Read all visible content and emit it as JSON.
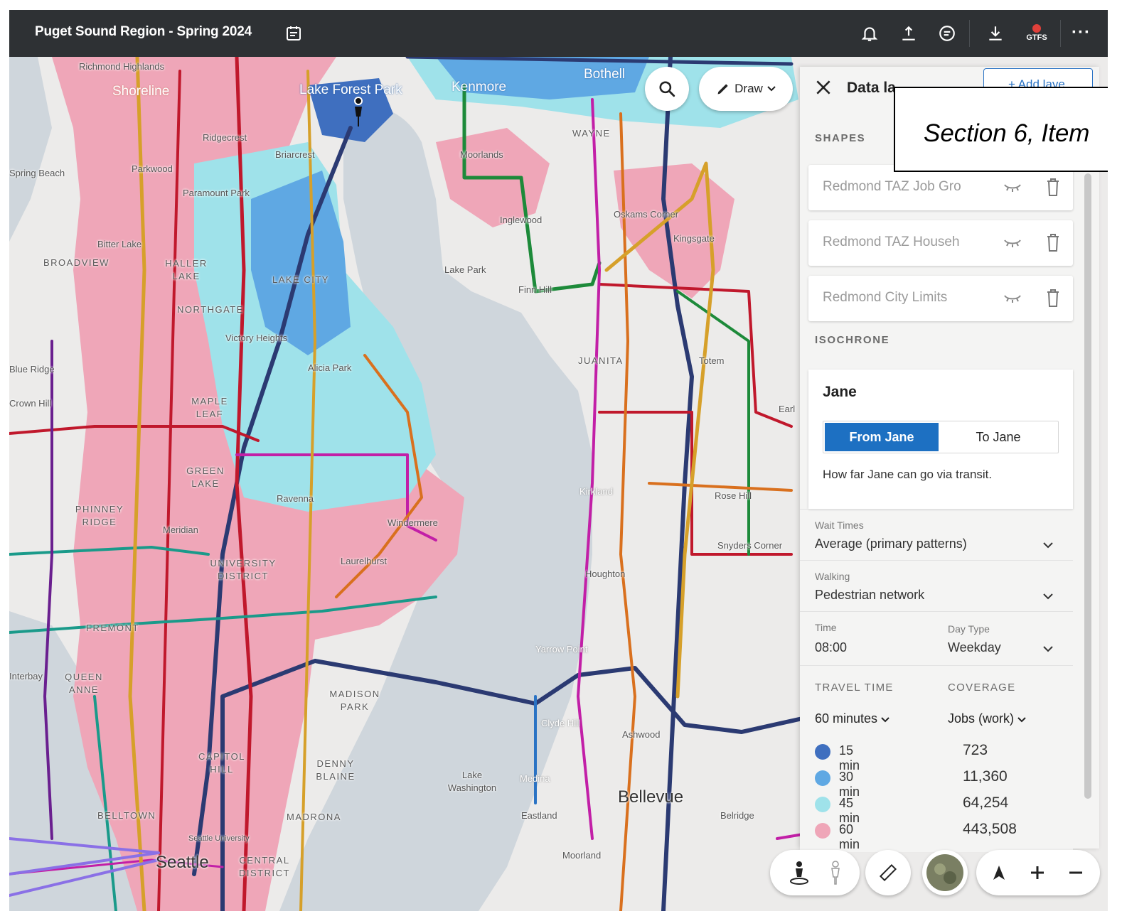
{
  "app": {
    "title": "Puget Sound Region - Spring 2024",
    "gtfs_label": "GTFS"
  },
  "toolbar": {
    "icons": [
      "calendar-icon",
      "bell-icon",
      "share-icon",
      "comment-icon",
      "download-icon",
      "gtfs-icon",
      "more-icon"
    ],
    "more_label": "···"
  },
  "map_controls": {
    "draw_label": "Draw"
  },
  "panel": {
    "title": "Data la",
    "add_layer_label": "+ Add laye",
    "shapes_heading": "SHAPES",
    "shapes": [
      {
        "name": "Redmond TAZ Job Gro"
      },
      {
        "name": "Redmond TAZ Househ"
      },
      {
        "name": "Redmond City Limits"
      }
    ],
    "isochrone_heading": "ISOCHRONE",
    "isochrone": {
      "name": "Jane",
      "from_label": "From Jane",
      "to_label": "To Jane",
      "description": "How far Jane can go via transit.",
      "wait_times_label": "Wait Times",
      "wait_times_value": "Average (primary patterns)",
      "walking_label": "Walking",
      "walking_value": "Pedestrian network",
      "time_label": "Time",
      "time_value": "08:00",
      "day_type_label": "Day Type",
      "day_type_value": "Weekday",
      "travel_time_heading": "TRAVEL TIME",
      "coverage_heading": "COVERAGE",
      "travel_time_value": "60 minutes",
      "coverage_value": "Jobs (work)",
      "legend": [
        {
          "label": "15 min",
          "value": "723",
          "color": "#3f6fbf"
        },
        {
          "label": "30 min",
          "value": "11,360",
          "color": "#5fa8e3"
        },
        {
          "label": "45 min",
          "value": "64,254",
          "color": "#9fe2ea"
        },
        {
          "label": "60 min",
          "value": "443,508",
          "color": "#efa6b8"
        }
      ]
    }
  },
  "callout": {
    "text": "Section 6, Item"
  },
  "map": {
    "labels": [
      "Richmond Highlands",
      "Shoreline",
      "Lake Forest Park",
      "Kenmore",
      "Bothell",
      "Ridgecrest",
      "Briarcrest",
      "Moorlands",
      "WAYNE",
      "Spring Beach",
      "Parkwood",
      "Paramount Park",
      "Inglewood",
      "Oskams Corner",
      "Kingsgate",
      "Bitter Lake",
      "BROADVIEW",
      "HALLER LAKE",
      "LAKE CITY",
      "Lake Park",
      "Finn Hill",
      "NORTHGATE",
      "Victory Heights",
      "Alicia Park",
      "JUANITA",
      "Totem",
      "Blue Ridge",
      "Crown Hill",
      "MAPLE LEAF",
      "Earl",
      "GREEN LAKE",
      "Ravenna",
      "Kirkland",
      "Rose Hill",
      "PHINNEY RIDGE",
      "Meridian",
      "Windermere",
      "Snyders Corner",
      "UNIVERSITY DISTRICT",
      "Laurelhurst",
      "Houghton",
      "FREMONT",
      "Yarrow Point",
      "Interbay",
      "QUEEN ANNE",
      "MADISON PARK",
      "Clyde Hill",
      "Ashwood",
      "CAPITOL HILL",
      "DENNY BLAINE",
      "Lake Washington",
      "Medina",
      "Bellevue",
      "BELLTOWN",
      "MADRONA",
      "Eastland",
      "Belridge",
      "Seattle",
      "CENTRAL DISTRICT",
      "Seattle University",
      "Moorland"
    ],
    "colors": {
      "pink": "#efa6b8",
      "cyan": "#9fe2ea",
      "light_blue": "#5fa8e3",
      "dark_blue": "#3f6fbf",
      "water": "#cfd6dc",
      "land": "#ecebea",
      "navy_route": "#2b3a72",
      "red_route": "#c0182c",
      "green_route": "#1d8a3a",
      "magenta_route": "#c21fa7",
      "orange_route": "#d9701e",
      "gold_route": "#d6a02a",
      "teal_route": "#1a9a8a"
    }
  },
  "bottom_controls": {
    "icons": [
      "pegman-icon",
      "pegman-outline-icon",
      "ruler-icon",
      "satellite-toggle-icon",
      "compass-icon",
      "zoom-in-icon",
      "zoom-out-icon"
    ]
  }
}
